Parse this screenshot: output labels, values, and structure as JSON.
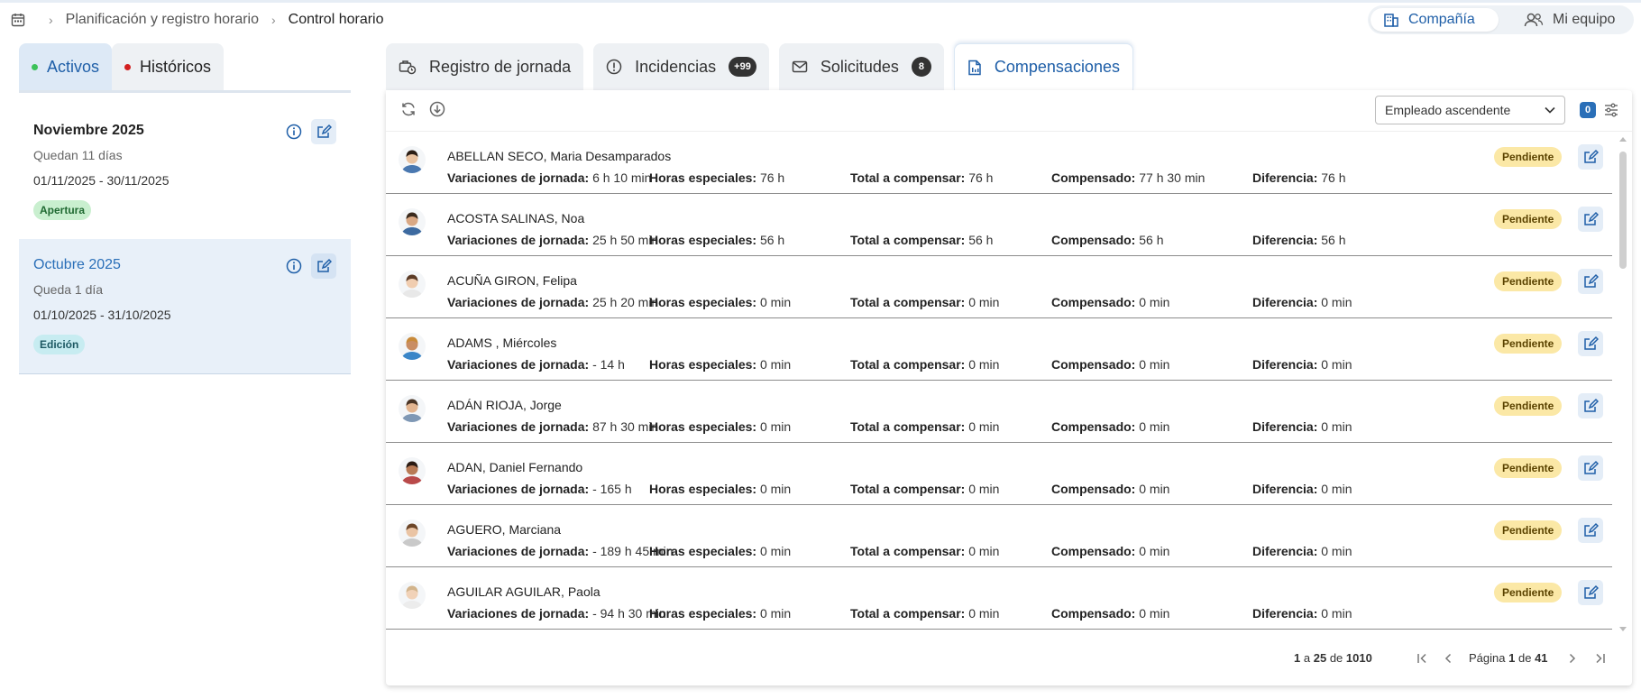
{
  "breadcrumb": {
    "items": [
      "Planificación y registro horario",
      "Control horario"
    ]
  },
  "scope_switch": {
    "company": "Compañía",
    "team": "Mi equipo"
  },
  "left_tabs": {
    "active": "Activos",
    "history": "Históricos"
  },
  "periods": [
    {
      "title": "Noviembre 2025",
      "remaining": "Quedan 11 días",
      "dates": "01/11/2025 - 30/11/2025",
      "badge": "Apertura"
    },
    {
      "title": "Octubre 2025",
      "remaining": "Queda 1 día",
      "dates": "01/10/2025 - 31/10/2025",
      "badge": "Edición"
    }
  ],
  "main_tabs": [
    {
      "label": "Registro de jornada",
      "count": ""
    },
    {
      "label": "Incidencias",
      "count": "+99"
    },
    {
      "label": "Solicitudes",
      "count": "8"
    },
    {
      "label": "Compensaciones",
      "count": ""
    }
  ],
  "toolbar": {
    "sort": "Empleado ascendente",
    "filter_count": "0"
  },
  "labels": {
    "variations": "Variaciones de jornada:",
    "special": "Horas especiales:",
    "total": "Total a compensar:",
    "compensated": "Compensado:",
    "difference": "Diferencia:"
  },
  "employees": [
    {
      "name": "ABELLAN SECO, Maria Desamparados",
      "variations": "6 h 10 min",
      "special": "76 h",
      "total": "76 h",
      "compensated": "77 h 30 min",
      "difference": "76 h",
      "status": "Pendiente"
    },
    {
      "name": "ACOSTA SALINAS, Noa",
      "variations": "25 h 50 min",
      "special": "56 h",
      "total": "56 h",
      "compensated": "56 h",
      "difference": "56 h",
      "status": "Pendiente"
    },
    {
      "name": "ACUÑA GIRON, Felipa",
      "variations": "25 h 20 min",
      "special": "0 min",
      "total": "0 min",
      "compensated": "0 min",
      "difference": "0 min",
      "status": "Pendiente"
    },
    {
      "name": "ADAMS , Miércoles",
      "variations": "- 14 h",
      "special": "0 min",
      "total": "0 min",
      "compensated": "0 min",
      "difference": "0 min",
      "status": "Pendiente"
    },
    {
      "name": "ADÁN RIOJA, Jorge",
      "variations": "87 h 30 min",
      "special": "0 min",
      "total": "0 min",
      "compensated": "0 min",
      "difference": "0 min",
      "status": "Pendiente"
    },
    {
      "name": "ADAN, Daniel Fernando",
      "variations": "- 165 h",
      "special": "0 min",
      "total": "0 min",
      "compensated": "0 min",
      "difference": "0 min",
      "status": "Pendiente"
    },
    {
      "name": "AGUERO, Marciana",
      "variations": "- 189 h 45 min",
      "special": "0 min",
      "total": "0 min",
      "compensated": "0 min",
      "difference": "0 min",
      "status": "Pendiente"
    },
    {
      "name": "AGUILAR AGUILAR, Paola",
      "variations": "- 94 h 30 min",
      "special": "0 min",
      "total": "0 min",
      "compensated": "0 min",
      "difference": "0 min",
      "status": "Pendiente"
    }
  ],
  "pager": {
    "from": "1",
    "a": "a",
    "to": "25",
    "de": "de",
    "total": "1010",
    "page_word": "Página",
    "page": "1",
    "pages": "41"
  },
  "colors": {
    "accent": "#1f5fa8",
    "pending_bg": "#fbe8a6",
    "active_green": "#3cc25a",
    "history_red": "#d32020"
  }
}
